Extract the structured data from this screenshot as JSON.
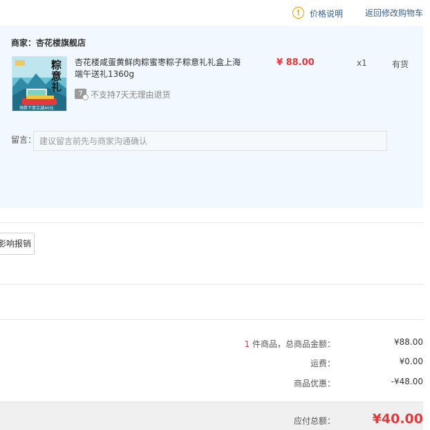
{
  "top_links": {
    "price_info": "价格说明",
    "back_to_cart": "返回修改购物车"
  },
  "shop": {
    "name_label": "商家：杏花楼旗舰店",
    "item": {
      "title": "杏花楼咸蛋黄鲜肉粽蜜枣粽子粽意礼礼盒上海端午送礼1360g",
      "price": "¥ 88.00",
      "quantity": "x1",
      "stock": "有货",
      "return_badge": "7",
      "return_policy": "不支持7天无理由退货",
      "thumb_text_1": "粽意礼",
      "thumb_text_2": "领券下单立减40元"
    },
    "message_label": "留言：",
    "message_placeholder": "建议留言前先与商家沟通确认"
  },
  "invoice": {
    "button_label": "影响报销"
  },
  "summary": {
    "item_count": "1",
    "item_total_label": " 件商品，总商品金额：",
    "item_total_value": "¥88.00",
    "shipping_label": "运费：",
    "shipping_value": "¥0.00",
    "discount_label": "商品优惠：",
    "discount_value": "-¥48.00",
    "payable_label": "应付总额：",
    "payable_value": "¥40.00"
  },
  "colors": {
    "accent_red": "#e4393c",
    "link_blue": "#3b5f8f",
    "panel_bg": "#f1f8ff",
    "warning_orange": "#e8a000"
  }
}
